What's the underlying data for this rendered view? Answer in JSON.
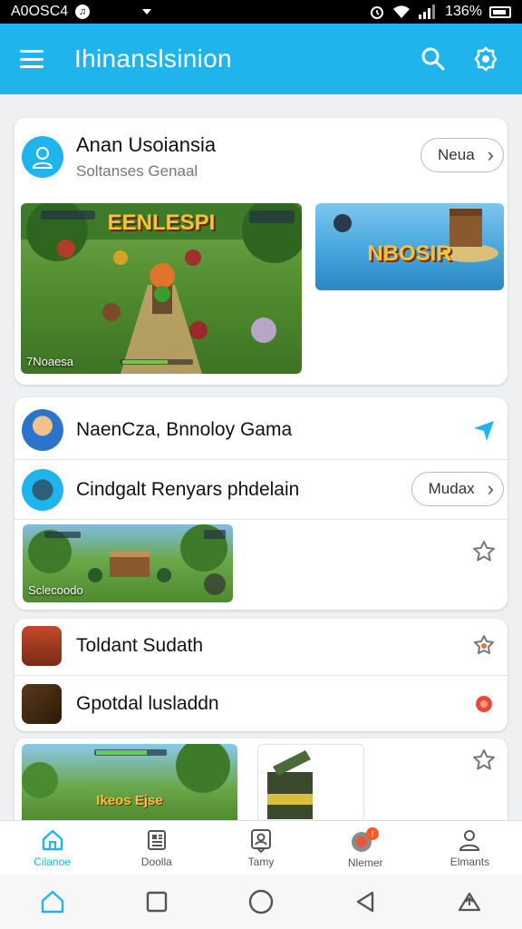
{
  "status": {
    "left_text": "A0OSC4",
    "battery": "136%"
  },
  "appbar": {
    "title": "Ihinanslsinion"
  },
  "card1": {
    "title": "Anan Usoiansia",
    "subtitle": "Soltanses Genaal",
    "button": "Neua",
    "hero_banner": "EENLESPI",
    "hero_caption": "7Noaesa",
    "side_banner": "NBOSIR"
  },
  "card2": {
    "row1": "NaenCza, Bnnoloy Gama",
    "row2": "Cindgalt Renyars phdelain",
    "row2_button": "Mudax",
    "thumb_caption": "Sclecoodo"
  },
  "card3": {
    "row1": "Toldant Sudath",
    "row2": "Gpotdal lusladdn"
  },
  "card4": {
    "banner": "Ikeos Ejse"
  },
  "nav": [
    {
      "label": "Cilanoe",
      "icon": "home-icon"
    },
    {
      "label": "Doolla",
      "icon": "document-icon"
    },
    {
      "label": "Tamy",
      "icon": "profile-card-icon"
    },
    {
      "label": "Nlemer",
      "icon": "notification-icon"
    },
    {
      "label": "Elmants",
      "icon": "person-icon"
    }
  ],
  "colors": {
    "accent": "#1fb5ec",
    "badge": "#ff5722"
  }
}
